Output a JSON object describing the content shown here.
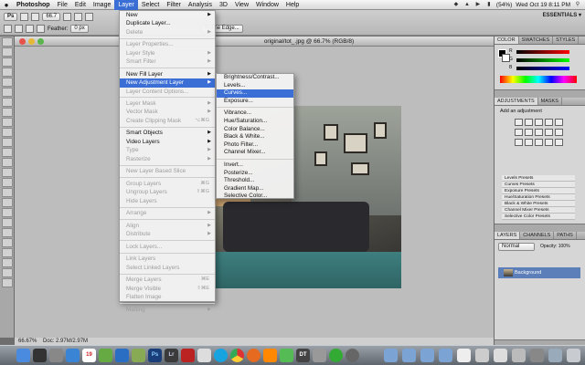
{
  "menubar": {
    "apple": "",
    "items": [
      {
        "label": "Photoshop",
        "app": true
      },
      {
        "label": "File"
      },
      {
        "label": "Edit"
      },
      {
        "label": "Image"
      },
      {
        "label": "Layer",
        "active": true
      },
      {
        "label": "Select"
      },
      {
        "label": "Filter"
      },
      {
        "label": "Analysis"
      },
      {
        "label": "3D"
      },
      {
        "label": "View"
      },
      {
        "label": "Window"
      },
      {
        "label": "Help"
      }
    ],
    "battery": "(54%)",
    "clock": "Wed Oct 19  8:11 PM"
  },
  "optbar": {
    "zoom": "66.7",
    "essentials": "ESSENTIALS ▾",
    "feather_label": "Feather:",
    "feather_value": "0 px",
    "refine_edge": "Refine Edge..."
  },
  "document": {
    "title": "original/tot_.jpg @ 66.7% (RGB/8)"
  },
  "statusbar": {
    "zoom": "66.67%",
    "doc": "Doc: 2.97M/2.97M"
  },
  "panels": {
    "color_tabs": [
      "COLOR",
      "SWATCHES",
      "STYLES"
    ],
    "rgb": [
      "R",
      "G",
      "B"
    ],
    "adj_tabs": [
      "ADJUSTMENTS",
      "MASKS"
    ],
    "adj_title": "Add an adjustment",
    "presets": [
      "Levels Presets",
      "Curves Presets",
      "Exposure Presets",
      "Hue/Saturation Presets",
      "Black & White Presets",
      "Channel Mixer Presets",
      "Selective Color Presets"
    ],
    "layer_tabs": [
      "LAYERS",
      "CHANNELS",
      "PATHS"
    ],
    "blend": "Normal",
    "opacity": "Opacity: 100%",
    "layer_name": "Background"
  },
  "menu": {
    "items": [
      {
        "label": "New",
        "arrow": true
      },
      {
        "label": "Duplicate Layer..."
      },
      {
        "label": "Delete",
        "disabled": true,
        "arrow": true
      },
      {
        "sep": true
      },
      {
        "label": "Layer Properties...",
        "disabled": true
      },
      {
        "label": "Layer Style",
        "disabled": true,
        "arrow": true
      },
      {
        "label": "Smart Filter",
        "disabled": true,
        "arrow": true
      },
      {
        "sep": true
      },
      {
        "label": "New Fill Layer",
        "arrow": true
      },
      {
        "label": "New Adjustment Layer",
        "arrow": true,
        "highlight": true
      },
      {
        "label": "Layer Content Options...",
        "disabled": true
      },
      {
        "sep": true
      },
      {
        "label": "Layer Mask",
        "disabled": true,
        "arrow": true
      },
      {
        "label": "Vector Mask",
        "disabled": true,
        "arrow": true
      },
      {
        "label": "Create Clipping Mask",
        "disabled": true,
        "shortcut": "⌥⌘G"
      },
      {
        "sep": true
      },
      {
        "label": "Smart Objects",
        "arrow": true
      },
      {
        "label": "Video Layers",
        "arrow": true
      },
      {
        "label": "Type",
        "disabled": true,
        "arrow": true
      },
      {
        "label": "Rasterize",
        "disabled": true,
        "arrow": true
      },
      {
        "sep": true
      },
      {
        "label": "New Layer Based Slice",
        "disabled": true
      },
      {
        "sep": true
      },
      {
        "label": "Group Layers",
        "disabled": true,
        "shortcut": "⌘G"
      },
      {
        "label": "Ungroup Layers",
        "disabled": true,
        "shortcut": "⇧⌘G"
      },
      {
        "label": "Hide Layers",
        "disabled": true
      },
      {
        "sep": true
      },
      {
        "label": "Arrange",
        "disabled": true,
        "arrow": true
      },
      {
        "sep": true
      },
      {
        "label": "Align",
        "disabled": true,
        "arrow": true
      },
      {
        "label": "Distribute",
        "disabled": true,
        "arrow": true
      },
      {
        "sep": true
      },
      {
        "label": "Lock Layers...",
        "disabled": true
      },
      {
        "sep": true
      },
      {
        "label": "Link Layers",
        "disabled": true
      },
      {
        "label": "Select Linked Layers",
        "disabled": true
      },
      {
        "sep": true
      },
      {
        "label": "Merge Layers",
        "disabled": true,
        "shortcut": "⌘E"
      },
      {
        "label": "Merge Visible",
        "disabled": true,
        "shortcut": "⇧⌘E"
      },
      {
        "label": "Flatten Image",
        "disabled": true
      },
      {
        "sep": true
      },
      {
        "label": "Matting",
        "disabled": true,
        "arrow": true
      }
    ]
  },
  "submenu": {
    "items": [
      {
        "label": "Brightness/Contrast..."
      },
      {
        "label": "Levels..."
      },
      {
        "label": "Curves...",
        "highlight": true
      },
      {
        "label": "Exposure..."
      },
      {
        "sep": true
      },
      {
        "label": "Vibrance..."
      },
      {
        "label": "Hue/Saturation..."
      },
      {
        "label": "Color Balance..."
      },
      {
        "label": "Black & White..."
      },
      {
        "label": "Photo Filter..."
      },
      {
        "label": "Channel Mixer..."
      },
      {
        "sep": true
      },
      {
        "label": "Invert..."
      },
      {
        "label": "Posterize..."
      },
      {
        "label": "Threshold..."
      },
      {
        "label": "Gradient Map..."
      },
      {
        "label": "Selective Color..."
      }
    ]
  },
  "dock": {
    "calendar_day": "19",
    "lightroom": "Lr",
    "photoshop": "Ps",
    "dt": "DT"
  },
  "colors": {
    "highlight": "#3b6fd6",
    "accent_photo_wall": "#9ea39a"
  }
}
